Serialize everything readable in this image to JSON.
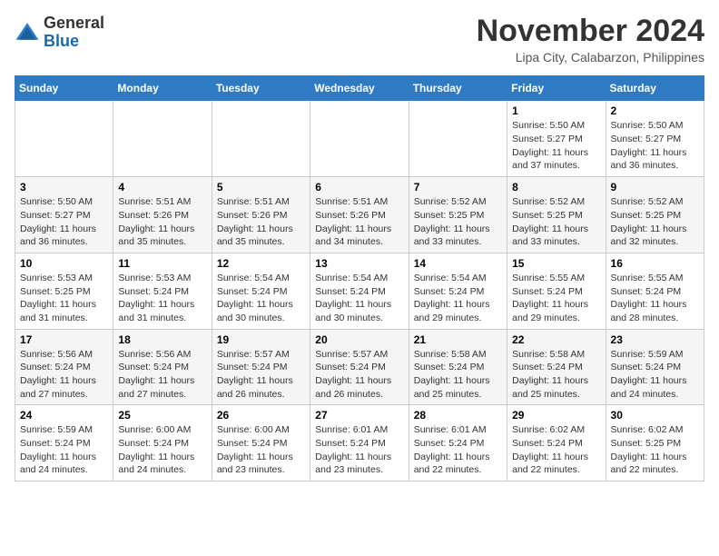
{
  "header": {
    "logo_general": "General",
    "logo_blue": "Blue",
    "month_year": "November 2024",
    "location": "Lipa City, Calabarzon, Philippines"
  },
  "days_of_week": [
    "Sunday",
    "Monday",
    "Tuesday",
    "Wednesday",
    "Thursday",
    "Friday",
    "Saturday"
  ],
  "weeks": [
    [
      {
        "day": "",
        "info": ""
      },
      {
        "day": "",
        "info": ""
      },
      {
        "day": "",
        "info": ""
      },
      {
        "day": "",
        "info": ""
      },
      {
        "day": "",
        "info": ""
      },
      {
        "day": "1",
        "info": "Sunrise: 5:50 AM\nSunset: 5:27 PM\nDaylight: 11 hours and 37 minutes."
      },
      {
        "day": "2",
        "info": "Sunrise: 5:50 AM\nSunset: 5:27 PM\nDaylight: 11 hours and 36 minutes."
      }
    ],
    [
      {
        "day": "3",
        "info": "Sunrise: 5:50 AM\nSunset: 5:27 PM\nDaylight: 11 hours and 36 minutes."
      },
      {
        "day": "4",
        "info": "Sunrise: 5:51 AM\nSunset: 5:26 PM\nDaylight: 11 hours and 35 minutes."
      },
      {
        "day": "5",
        "info": "Sunrise: 5:51 AM\nSunset: 5:26 PM\nDaylight: 11 hours and 35 minutes."
      },
      {
        "day": "6",
        "info": "Sunrise: 5:51 AM\nSunset: 5:26 PM\nDaylight: 11 hours and 34 minutes."
      },
      {
        "day": "7",
        "info": "Sunrise: 5:52 AM\nSunset: 5:25 PM\nDaylight: 11 hours and 33 minutes."
      },
      {
        "day": "8",
        "info": "Sunrise: 5:52 AM\nSunset: 5:25 PM\nDaylight: 11 hours and 33 minutes."
      },
      {
        "day": "9",
        "info": "Sunrise: 5:52 AM\nSunset: 5:25 PM\nDaylight: 11 hours and 32 minutes."
      }
    ],
    [
      {
        "day": "10",
        "info": "Sunrise: 5:53 AM\nSunset: 5:25 PM\nDaylight: 11 hours and 31 minutes."
      },
      {
        "day": "11",
        "info": "Sunrise: 5:53 AM\nSunset: 5:24 PM\nDaylight: 11 hours and 31 minutes."
      },
      {
        "day": "12",
        "info": "Sunrise: 5:54 AM\nSunset: 5:24 PM\nDaylight: 11 hours and 30 minutes."
      },
      {
        "day": "13",
        "info": "Sunrise: 5:54 AM\nSunset: 5:24 PM\nDaylight: 11 hours and 30 minutes."
      },
      {
        "day": "14",
        "info": "Sunrise: 5:54 AM\nSunset: 5:24 PM\nDaylight: 11 hours and 29 minutes."
      },
      {
        "day": "15",
        "info": "Sunrise: 5:55 AM\nSunset: 5:24 PM\nDaylight: 11 hours and 29 minutes."
      },
      {
        "day": "16",
        "info": "Sunrise: 5:55 AM\nSunset: 5:24 PM\nDaylight: 11 hours and 28 minutes."
      }
    ],
    [
      {
        "day": "17",
        "info": "Sunrise: 5:56 AM\nSunset: 5:24 PM\nDaylight: 11 hours and 27 minutes."
      },
      {
        "day": "18",
        "info": "Sunrise: 5:56 AM\nSunset: 5:24 PM\nDaylight: 11 hours and 27 minutes."
      },
      {
        "day": "19",
        "info": "Sunrise: 5:57 AM\nSunset: 5:24 PM\nDaylight: 11 hours and 26 minutes."
      },
      {
        "day": "20",
        "info": "Sunrise: 5:57 AM\nSunset: 5:24 PM\nDaylight: 11 hours and 26 minutes."
      },
      {
        "day": "21",
        "info": "Sunrise: 5:58 AM\nSunset: 5:24 PM\nDaylight: 11 hours and 25 minutes."
      },
      {
        "day": "22",
        "info": "Sunrise: 5:58 AM\nSunset: 5:24 PM\nDaylight: 11 hours and 25 minutes."
      },
      {
        "day": "23",
        "info": "Sunrise: 5:59 AM\nSunset: 5:24 PM\nDaylight: 11 hours and 24 minutes."
      }
    ],
    [
      {
        "day": "24",
        "info": "Sunrise: 5:59 AM\nSunset: 5:24 PM\nDaylight: 11 hours and 24 minutes."
      },
      {
        "day": "25",
        "info": "Sunrise: 6:00 AM\nSunset: 5:24 PM\nDaylight: 11 hours and 24 minutes."
      },
      {
        "day": "26",
        "info": "Sunrise: 6:00 AM\nSunset: 5:24 PM\nDaylight: 11 hours and 23 minutes."
      },
      {
        "day": "27",
        "info": "Sunrise: 6:01 AM\nSunset: 5:24 PM\nDaylight: 11 hours and 23 minutes."
      },
      {
        "day": "28",
        "info": "Sunrise: 6:01 AM\nSunset: 5:24 PM\nDaylight: 11 hours and 22 minutes."
      },
      {
        "day": "29",
        "info": "Sunrise: 6:02 AM\nSunset: 5:24 PM\nDaylight: 11 hours and 22 minutes."
      },
      {
        "day": "30",
        "info": "Sunrise: 6:02 AM\nSunset: 5:25 PM\nDaylight: 11 hours and 22 minutes."
      }
    ]
  ]
}
